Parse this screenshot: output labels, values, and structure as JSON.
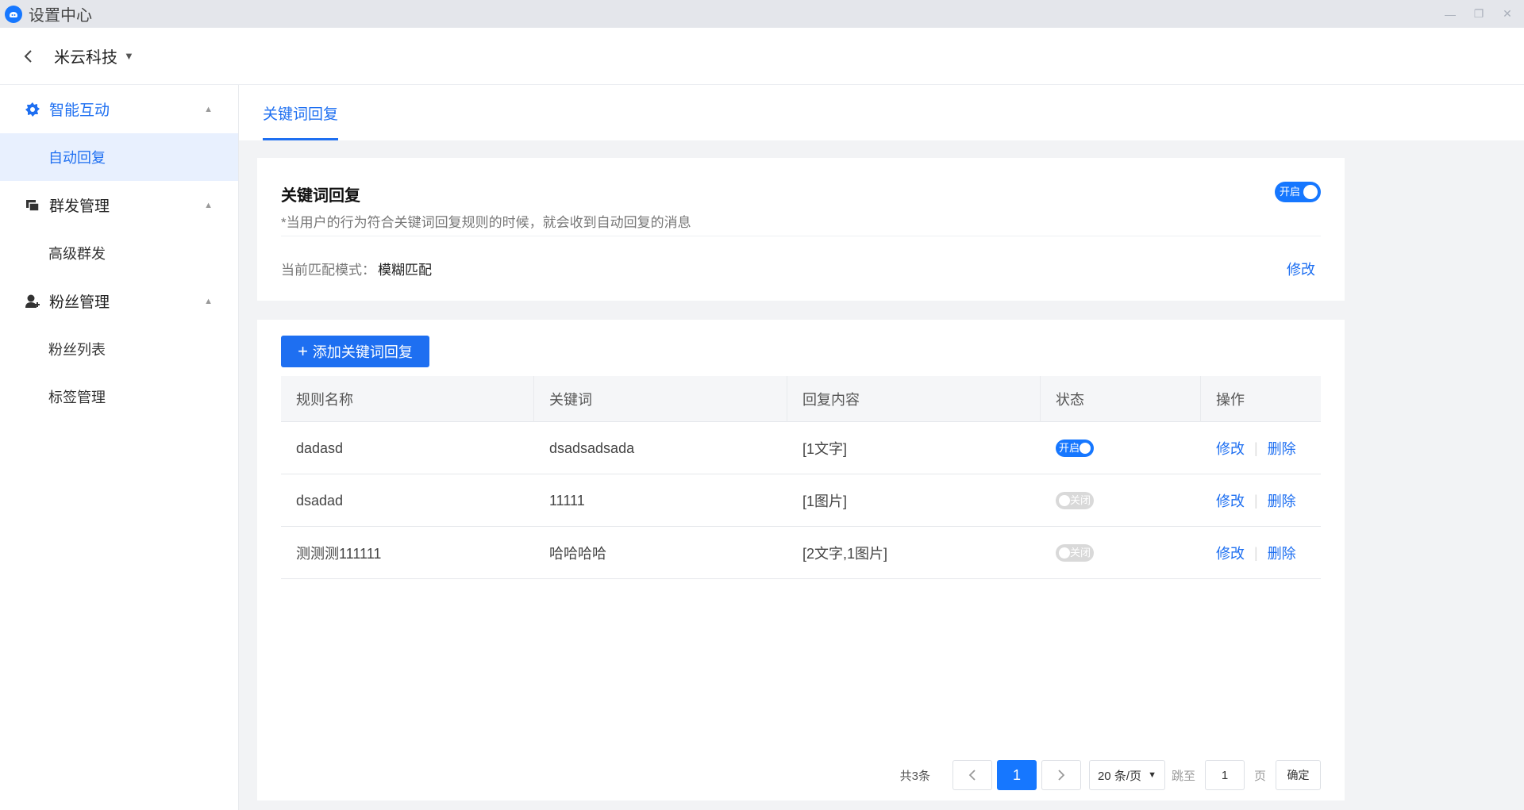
{
  "window": {
    "title": "设置中心",
    "controls": [
      "—",
      "❐",
      "✕"
    ]
  },
  "header": {
    "company": "米云科技",
    "caret": "▼"
  },
  "sidebar": {
    "groups": [
      {
        "label": "智能互动",
        "icon": "gear-icon",
        "active": true,
        "items": [
          {
            "label": "自动回复",
            "active": true
          }
        ]
      },
      {
        "label": "群发管理",
        "icon": "broadcast-icon",
        "active": false,
        "items": [
          {
            "label": "高级群发",
            "active": false
          }
        ]
      },
      {
        "label": "粉丝管理",
        "icon": "user-icon",
        "active": false,
        "items": [
          {
            "label": "粉丝列表",
            "active": false
          },
          {
            "label": "标签管理",
            "active": false
          }
        ]
      }
    ]
  },
  "tabs": [
    {
      "label": "关键词回复",
      "active": true
    }
  ],
  "settings_card": {
    "title": "关键词回复",
    "description": "*当用户的行为符合关键词回复规则的时候，就会收到自动回复的消息",
    "switch_label": "开启",
    "switch_on": true,
    "mode_label": "当前匹配模式：",
    "mode_value": "模糊匹配",
    "modify": "修改"
  },
  "rules": {
    "add_button": "添加关键词回复",
    "columns": [
      "规则名称",
      "关键词",
      "回复内容",
      "状态",
      "操作"
    ],
    "rows": [
      {
        "name": "dadasd",
        "keyword": "dsadsadsada",
        "content": "[1文字]",
        "status": "开启",
        "on": true,
        "edit": "修改",
        "delete": "删除"
      },
      {
        "name": "dsadad",
        "keyword": "11111",
        "content": "[1图片]",
        "status": "关闭",
        "on": false,
        "edit": "修改",
        "delete": "删除"
      },
      {
        "name": "测测测111111",
        "keyword": "哈哈哈哈",
        "content": "[2文字,1图片]",
        "status": "关闭",
        "on": false,
        "edit": "修改",
        "delete": "删除"
      }
    ]
  },
  "pagination": {
    "total": "共3条",
    "current_page": "1",
    "page_size": "20 条/页",
    "jump_label": "跳至",
    "jump_value": "1",
    "page_label": "页",
    "confirm": "确定"
  },
  "colors": {
    "primary": "#1e6ff1",
    "switch_on": "#1677ff",
    "switch_off": "#d9d9d9"
  }
}
